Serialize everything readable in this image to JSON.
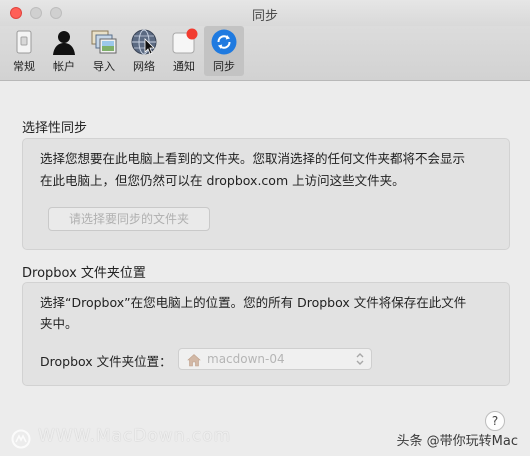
{
  "window": {
    "title": "同步"
  },
  "toolbar": {
    "tabs": [
      {
        "label": "常规",
        "icon": "general-switch-icon"
      },
      {
        "label": "帐户",
        "icon": "account-person-icon"
      },
      {
        "label": "导入",
        "icon": "import-photos-icon"
      },
      {
        "label": "网络",
        "icon": "network-globe-icon"
      },
      {
        "label": "通知",
        "icon": "notification-icon"
      },
      {
        "label": "同步",
        "icon": "sync-icon",
        "active": true
      }
    ]
  },
  "selective_sync": {
    "heading": "选择性同步",
    "description_line1": "选择您想要在此电脑上看到的文件夹。您取消选择的任何文件夹都将不会显示",
    "description_line2": "在此电脑上，但您仍然可以在 dropbox.com 上访问这些文件夹。",
    "button_label": "请选择要同步的文件夹"
  },
  "folder_location": {
    "heading": "Dropbox 文件夹位置",
    "description_line1": "选择“Dropbox”在您电脑上的位置。您的所有 Dropbox 文件将保存在此文件",
    "description_line2": "夹中。",
    "field_label": "Dropbox 文件夹位置：",
    "selected_value": "macdown-04"
  },
  "help_label": "?",
  "watermark": {
    "left_text": "WWW.MacDown.com",
    "right_text": "头条 @带你玩转Mac"
  },
  "colors": {
    "close": "#ff5f57",
    "sync_blue": "#1f7ae0",
    "badge_red": "#f23b2f"
  }
}
